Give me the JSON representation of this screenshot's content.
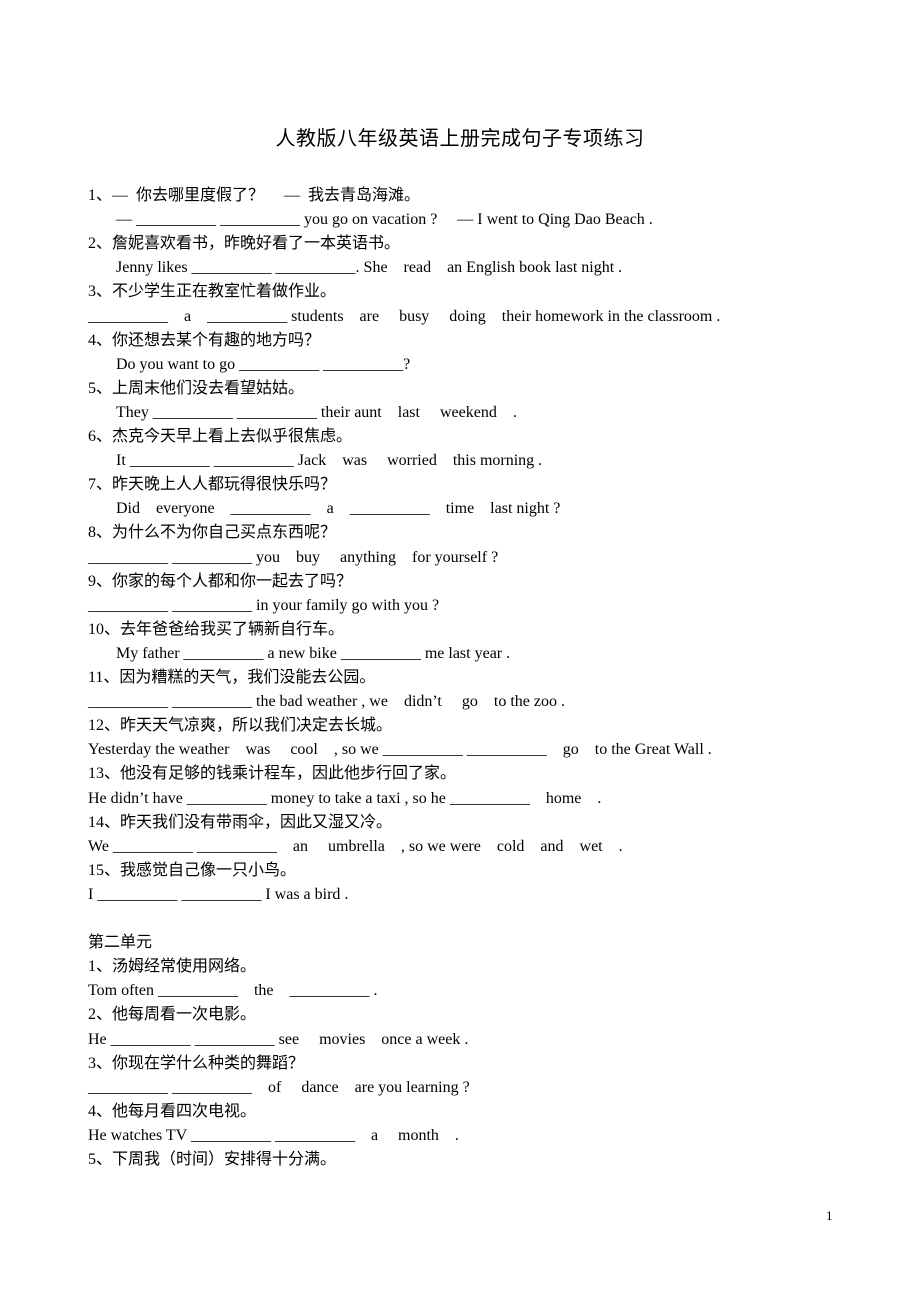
{
  "title": "人教版八年级英语上册完成句子专项练习",
  "lines": [
    {
      "text": "1、—  你去哪里度假了？     —  我去青岛海滩。",
      "indent": false
    },
    {
      "text": "— __________ __________ you go on vacation ?     — I went to Qing Dao Beach .",
      "indent": true
    },
    {
      "text": "2、詹妮喜欢看书，昨晚好看了一本英语书。",
      "indent": false
    },
    {
      "text": "Jenny likes __________ __________. She    read    an English book last night .",
      "indent": true
    },
    {
      "text": "3、不少学生正在教室忙着做作业。",
      "indent": false
    },
    {
      "text": "__________    a    __________ students    are     busy     doing    their homework in the classroom .",
      "indent": false
    },
    {
      "text": "4、你还想去某个有趣的地方吗？",
      "indent": false
    },
    {
      "text": "Do you want to go __________ __________?",
      "indent": true
    },
    {
      "text": "5、上周末他们没去看望姑姑。",
      "indent": false
    },
    {
      "text": "They __________ __________ their aunt    last     weekend    .",
      "indent": true
    },
    {
      "text": "6、杰克今天早上看上去似乎很焦虑。",
      "indent": false
    },
    {
      "text": "It __________ __________ Jack    was     worried    this morning .",
      "indent": true
    },
    {
      "text": "7、昨天晚上人人都玩得很快乐吗？",
      "indent": false
    },
    {
      "text": "Did    everyone    __________    a    __________    time    last night ?",
      "indent": true
    },
    {
      "text": "8、为什么不为你自己买点东西呢？",
      "indent": false
    },
    {
      "text": "__________ __________ you    buy     anything    for yourself ?",
      "indent": false
    },
    {
      "text": "9、你家的每个人都和你一起去了吗？",
      "indent": false
    },
    {
      "text": "__________ __________ in your family go with you ?",
      "indent": false
    },
    {
      "text": "10、去年爸爸给我买了辆新自行车。",
      "indent": false
    },
    {
      "text": "My father __________ a new bike __________ me last year .",
      "indent": true
    },
    {
      "text": "11、因为糟糕的天气，我们没能去公园。",
      "indent": false
    },
    {
      "text": "__________ __________ the bad weather , we    didn’t     go    to the zoo .",
      "indent": false
    },
    {
      "text": "12、昨天天气凉爽，所以我们决定去长城。",
      "indent": false
    },
    {
      "text": "Yesterday the weather    was     cool    , so we __________ __________    go    to the Great Wall .",
      "indent": false
    },
    {
      "text": "13、他没有足够的钱乘计程车，因此他步行回了家。",
      "indent": false
    },
    {
      "text": "He didn’t have __________ money to take a taxi , so he __________    home    .",
      "indent": false
    },
    {
      "text": "14、昨天我们没有带雨伞，因此又湿又冷。",
      "indent": false
    },
    {
      "text": "We __________ __________    an     umbrella    , so we were    cold    and    wet    .",
      "indent": false
    },
    {
      "text": "15、我感觉自己像一只小鸟。",
      "indent": false
    },
    {
      "text": "I __________ __________ I was a bird .",
      "indent": false
    },
    {
      "text": "",
      "indent": false
    },
    {
      "text": "第二单元",
      "indent": false
    },
    {
      "text": "1、汤姆经常使用网络。",
      "indent": false
    },
    {
      "text": "Tom often __________    the    __________ .",
      "indent": false
    },
    {
      "text": "2、他每周看一次电影。",
      "indent": false
    },
    {
      "text": "He __________ __________ see     movies    once a week .",
      "indent": false
    },
    {
      "text": "3、你现在学什么种类的舞蹈？",
      "indent": false
    },
    {
      "text": "__________ __________    of     dance    are you learning ?",
      "indent": false
    },
    {
      "text": "4、他每月看四次电视。",
      "indent": false
    },
    {
      "text": "He watches TV __________ __________    a     month    .",
      "indent": false
    },
    {
      "text": "5、下周我（时间）安排得十分满。",
      "indent": false
    }
  ],
  "page_number": "1"
}
